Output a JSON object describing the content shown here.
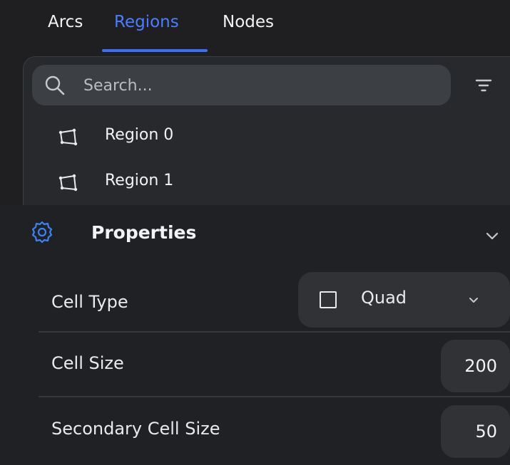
{
  "tabs": [
    {
      "label": "Arcs",
      "active": false
    },
    {
      "label": "Regions",
      "active": true
    },
    {
      "label": "Nodes",
      "active": false
    }
  ],
  "search": {
    "placeholder": "Search...",
    "value": ""
  },
  "regions": [
    {
      "label": "Region 0",
      "icon": "polygon-icon"
    },
    {
      "label": "Region 1",
      "icon": "polygon-icon"
    }
  ],
  "properties": {
    "title": "Properties",
    "icon": "gear-icon",
    "cell_type": {
      "label": "Cell Type",
      "value": "Quad",
      "icon": "square-icon"
    },
    "cell_size": {
      "label": "Cell Size",
      "value": "200"
    },
    "secondary_cell_size": {
      "label": "Secondary Cell Size",
      "value": "50"
    }
  },
  "colors": {
    "accent": "#4a7dff",
    "background": "#202124",
    "panel": "#27292c",
    "field": "#303236"
  }
}
